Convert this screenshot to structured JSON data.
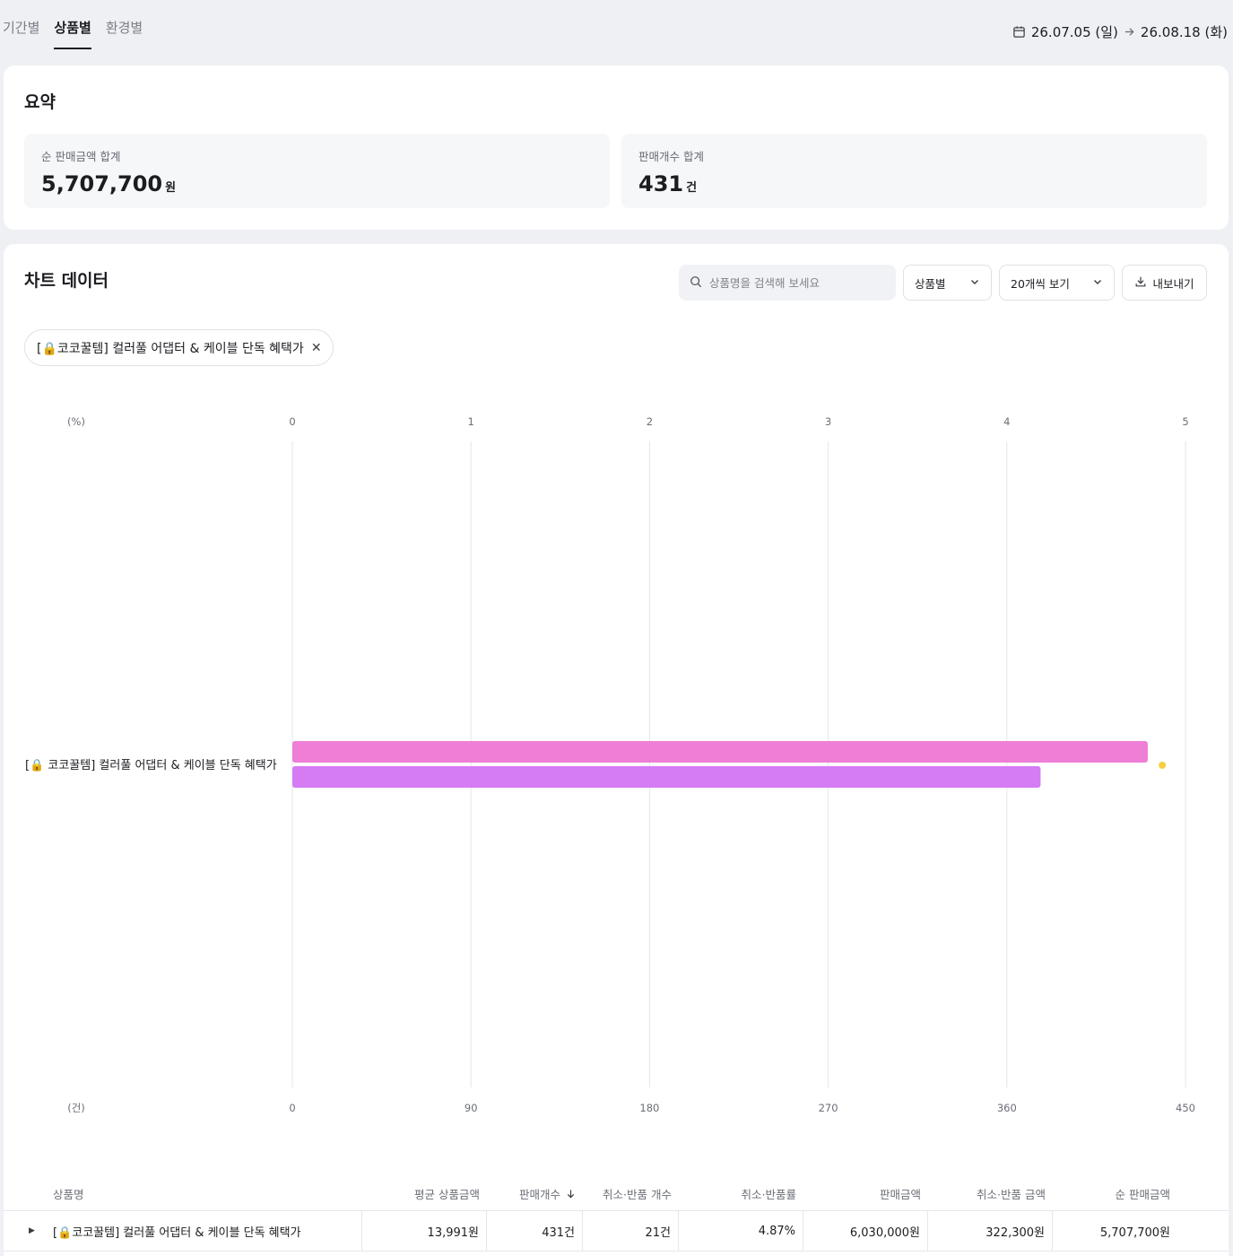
{
  "tabs": [
    {
      "label": "기간별",
      "active": false
    },
    {
      "label": "상품별",
      "active": true
    },
    {
      "label": "환경별",
      "active": false
    }
  ],
  "date_range": {
    "start": "26.07.05 (일)",
    "end": "26.08.18 (화)",
    "icon": "calendar-icon",
    "separator_icon": "arrow-right-icon"
  },
  "summary": {
    "title": "요약",
    "metrics": [
      {
        "label": "순 판매금액 합계",
        "value": "5,707,700",
        "unit": "원"
      },
      {
        "label": "판매개수 합계",
        "value": "431",
        "unit": "건"
      }
    ]
  },
  "chart_section": {
    "title": "차트 데이터",
    "search_placeholder": "상품명을 검색해 보세요",
    "group_select": "상품별",
    "page_size_select": "20개씩 보기",
    "export_label": "내보내기",
    "filter_chip": "[🔒코코꿀템] 컬러풀 어댑터 & 케이블 단독 혜택가"
  },
  "chart_data": {
    "type": "bar",
    "orientation": "horizontal",
    "categories": [
      "[🔒 코코꿀템] 컬러풀 어댑터 & 케이블 단독 혜택가"
    ],
    "top_axis": {
      "unit_label": "(%)",
      "ticks": [
        "0",
        "1",
        "2",
        "3",
        "4",
        "5"
      ],
      "range": [
        0,
        5
      ]
    },
    "bottom_axis": {
      "unit_label": "(건)",
      "ticks": [
        "0",
        "90",
        "180",
        "270",
        "360",
        "450"
      ],
      "range": [
        0,
        450
      ]
    },
    "series": [
      {
        "axis": "bottom",
        "values": [
          431
        ],
        "color": "#ee7ed6"
      },
      {
        "axis": "bottom",
        "values": [
          377
        ],
        "color": "#d57bf4"
      },
      {
        "axis": "top",
        "type": "point",
        "values": [
          4.87
        ],
        "color": "#f6cf3d"
      }
    ],
    "grid": true
  },
  "table": {
    "columns": [
      "상품명",
      "평균 상품금액",
      "판매개수",
      "취소·반품 개수",
      "취소·반품률",
      "판매금액",
      "취소·반품 금액",
      "순 판매금액"
    ],
    "rows": [
      [
        "[🔒코코꿀템] 컬러풀 어댑터 & 케이블 단독 혜택가",
        "13,991원",
        "431건",
        "21건",
        "4.87%",
        "6,030,000원",
        "322,300원",
        "5,707,700원"
      ]
    ]
  },
  "colors": {
    "accent_dark": "#1c1d21",
    "background": "#eff0f4"
  }
}
